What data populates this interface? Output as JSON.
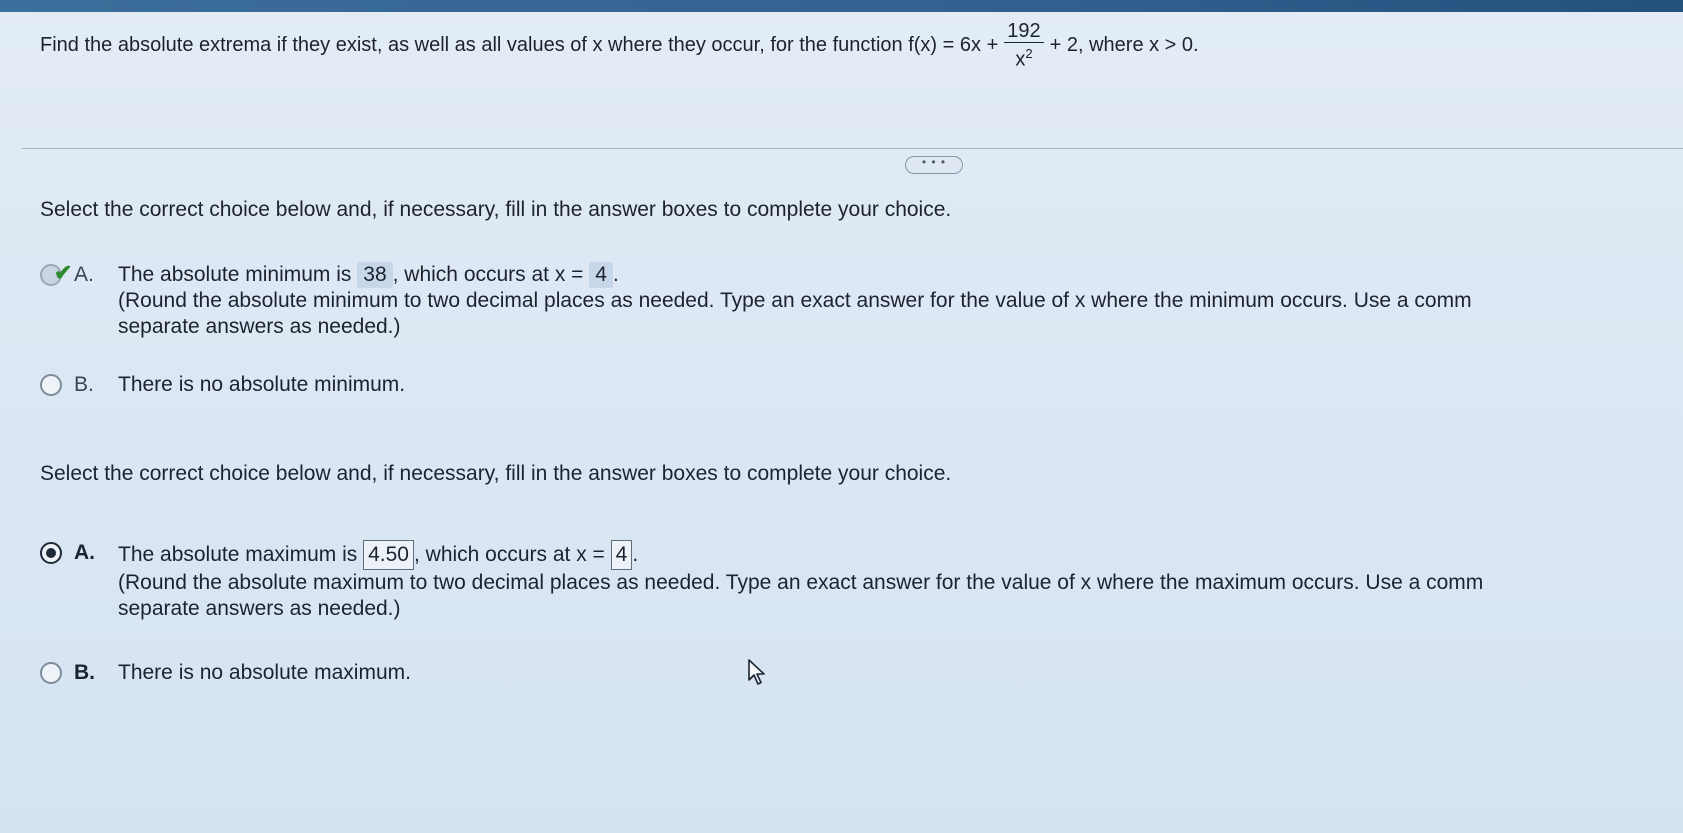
{
  "question": {
    "prefix": "Find the absolute extrema if they exist, as well as all values of x where they occur, for the function f(x) = 6x +",
    "fraction_numerator": "192",
    "fraction_denominator": "x",
    "fraction_exponent": "2",
    "suffix": "+ 2, where x > 0."
  },
  "more_button": "• • •",
  "section_min": {
    "instruction": "Select the correct choice below and, if necessary, fill in the answer boxes to complete your choice.",
    "choice_a": {
      "letter": "A.",
      "text1": "The absolute minimum is",
      "value": "38",
      "text2": ", which occurs at x =",
      "x_value": "4",
      "text3": ".",
      "note_line1": "(Round the absolute minimum to two decimal places as needed. Type an exact answer for the value of x where the minimum occurs. Use a comm",
      "note_line2": "separate answers as needed.)",
      "status": "correct"
    },
    "choice_b": {
      "letter": "B.",
      "text": "There is no absolute minimum."
    }
  },
  "section_max": {
    "instruction": "Select the correct choice below and, if necessary, fill in the answer boxes to complete your choice.",
    "choice_a": {
      "letter": "A.",
      "text1": "The absolute maximum is",
      "value": "4.50",
      "text2": ", which occurs at x =",
      "x_value": "4",
      "text3": ".",
      "note_line1": "(Round the absolute maximum to two decimal places as needed. Type an exact answer for the value of x where the maximum occurs. Use a comm",
      "note_line2": "separate answers as needed.)",
      "selected": true
    },
    "choice_b": {
      "letter": "B.",
      "text": "There is no absolute maximum."
    }
  },
  "colors": {
    "top_bar": "#2f5e8c",
    "check": "#2f8a2f",
    "background": "#dce7f3"
  },
  "icons": {
    "check": "check-mark-icon",
    "cursor": "mouse-pointer-icon"
  }
}
